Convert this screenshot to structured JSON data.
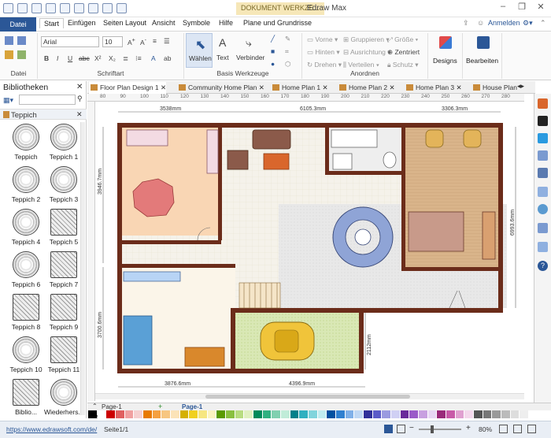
{
  "titlebar": {
    "doc_tab": "DOKUMENT WERKZE...",
    "app_title": "Edraw Max",
    "min": "–",
    "max": "❐",
    "close": "✕"
  },
  "menu": {
    "datei": "Datei",
    "items": [
      "Start",
      "Einfügen",
      "Seiten Layout",
      "Ansicht",
      "Symbole",
      "Hilfe",
      "Plane und Grundrisse"
    ],
    "anmelden": "Anmelden"
  },
  "ribbon": {
    "groups": {
      "datei": "Datei",
      "schriftart": "Schriftart",
      "basis": "Basis Werkzeuge",
      "anordnen": "Anordnen"
    },
    "font_family": "Arial",
    "font_size": "10",
    "tools": {
      "waehlen": "Wählen",
      "text": "Text",
      "verbinder": "Verbinder"
    },
    "arrange": {
      "vorne": "Vorne",
      "hinten": "Hinten",
      "drehen": "Drehen",
      "gruppieren": "Gruppieren",
      "ausrichtung": "Ausrichtung",
      "verteilen": "Verteilen",
      "groesse": "Größe",
      "zentriert": "Zentriert",
      "schutz": "Schutz"
    },
    "designs": "Designs",
    "bearbeiten": "Bearbeiten"
  },
  "library": {
    "title": "Bibliotheken",
    "section": "Teppich",
    "items": [
      "Teppich",
      "Teppich 1",
      "Teppich 2",
      "Teppich 3",
      "Teppich 4",
      "Teppich 5",
      "Teppich 6",
      "Teppich 7",
      "Teppich 8",
      "Teppich 9",
      "Teppich 10",
      "Teppich 11",
      "Biblio...",
      "Wiederhers..."
    ]
  },
  "tabs": [
    "Floor Plan Design 1",
    "Community Home Plan",
    "Home Plan 1",
    "Home Plan 2",
    "Home Plan 3",
    "House Plan"
  ],
  "ruler_numbers": [
    "80",
    "90",
    "100",
    "110",
    "120",
    "130",
    "140",
    "150",
    "160",
    "170",
    "180",
    "190",
    "200",
    "210",
    "220",
    "230",
    "240",
    "250",
    "260",
    "270",
    "280"
  ],
  "dimensions": {
    "top_left": "3538mm",
    "top_mid": "6105.3mm",
    "top_right": "3306.3mm",
    "left_upper": "3946.7mm",
    "left_lower": "3700.6mm",
    "right": "6993.6mm",
    "garage_height": "2112mm",
    "bottom_left": "3876.6mm",
    "bottom_mid": "4396.9mm"
  },
  "pagebar": {
    "page_select": "Page-1",
    "page_tab": "Page-1",
    "fueller": "üller"
  },
  "status": {
    "url": "https://www.edrawsoft.com/de/",
    "page_info": "Seite1/1",
    "zoom": "80%"
  }
}
